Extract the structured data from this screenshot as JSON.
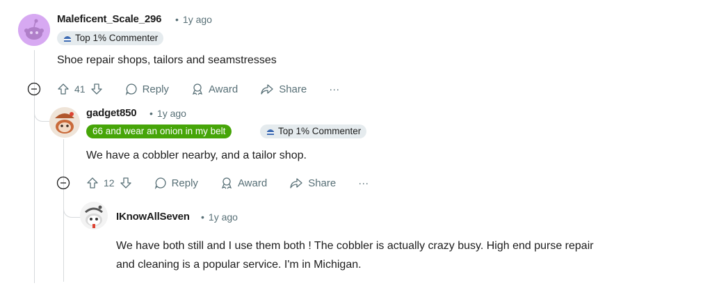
{
  "comments": [
    {
      "username": "Maleficent_Scale_296",
      "time": "1y ago",
      "badges": [
        "Top 1% Commenter"
      ],
      "body": "Shoe repair shops, tailors and seamstresses",
      "votes": "41",
      "reply_label": "Reply",
      "award_label": "Award",
      "share_label": "Share",
      "more_label": "···"
    },
    {
      "username": "gadget850",
      "time": "1y ago",
      "flair": "66 and wear an onion in my belt",
      "badges": [
        "Top 1% Commenter"
      ],
      "body": "We have a cobbler nearby, and a tailor shop.",
      "votes": "12",
      "reply_label": "Reply",
      "award_label": "Award",
      "share_label": "Share",
      "more_label": "···"
    },
    {
      "username": "IKnowAllSeven",
      "time": "1y ago",
      "body_line1": "We have both still and I use them both ! The cobbler is actually crazy busy. High end purse repair",
      "body_line2": "and cleaning is a popular service. I'm in Michigan."
    }
  ],
  "colors": {
    "flair_bg": "#46a508",
    "badge_bg": "#e5ebee",
    "meta_text": "#576f76",
    "thread_line": "#d6d9dc",
    "avatar1_bg": "#d6a8f0"
  },
  "icons": {
    "badge": "top-commenter-icon",
    "upvote": "upvote-arrow-icon",
    "downvote": "downvote-arrow-icon",
    "reply": "comment-bubble-icon",
    "award": "award-ribbon-icon",
    "share": "share-arrow-icon",
    "collapse": "minus-circle-icon"
  }
}
